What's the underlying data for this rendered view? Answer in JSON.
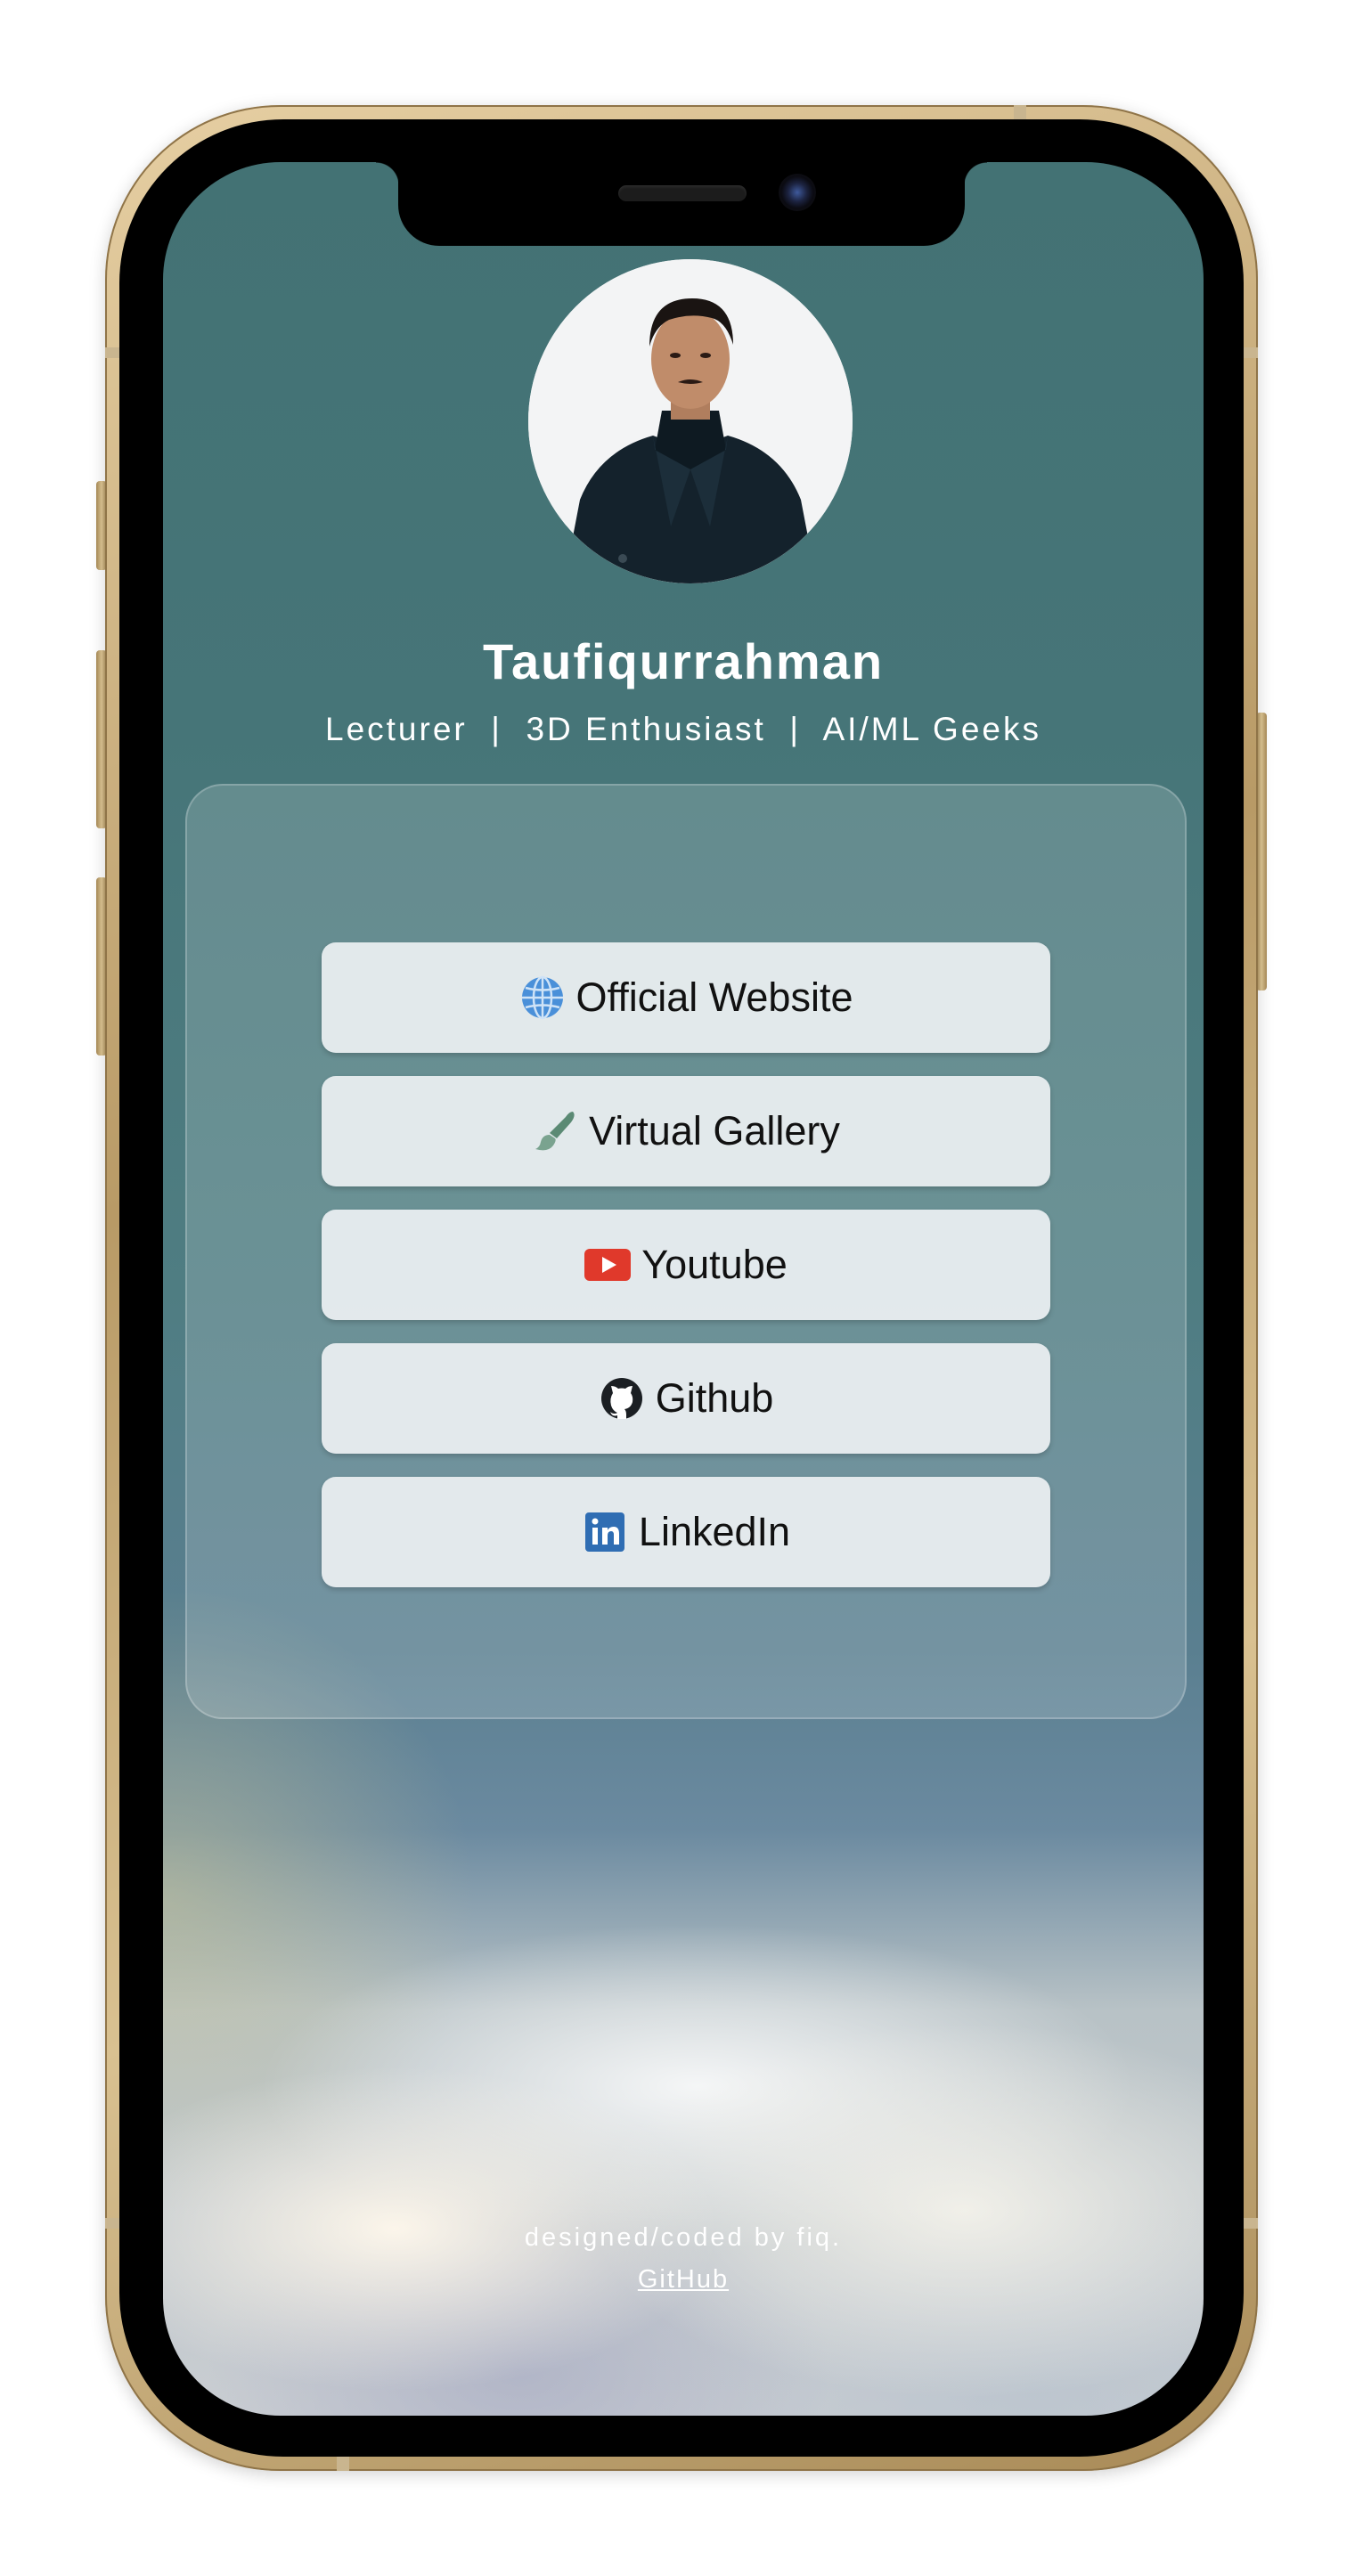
{
  "profile": {
    "name": "Taufiqurrahman",
    "tagline": "Lecturer  |  3D Enthusiast  |  AI/ML Geeks"
  },
  "links": [
    {
      "label": "Official Website",
      "icon": "globe-icon"
    },
    {
      "label": "Virtual Gallery",
      "icon": "paintbrush-icon"
    },
    {
      "label": "Youtube",
      "icon": "youtube-icon"
    },
    {
      "label": "Github",
      "icon": "github-icon"
    },
    {
      "label": "LinkedIn",
      "icon": "linkedin-icon"
    }
  ],
  "footer": {
    "credit": "designed/coded by fiq.",
    "link_label": "GitHub"
  },
  "colors": {
    "background_top": "#437274",
    "text": "#ffffff",
    "button_bg": "#ecf0f2",
    "youtube_red": "#e0392b",
    "linkedin_blue": "#2f6db3",
    "globe_blue": "#4a90d9"
  }
}
